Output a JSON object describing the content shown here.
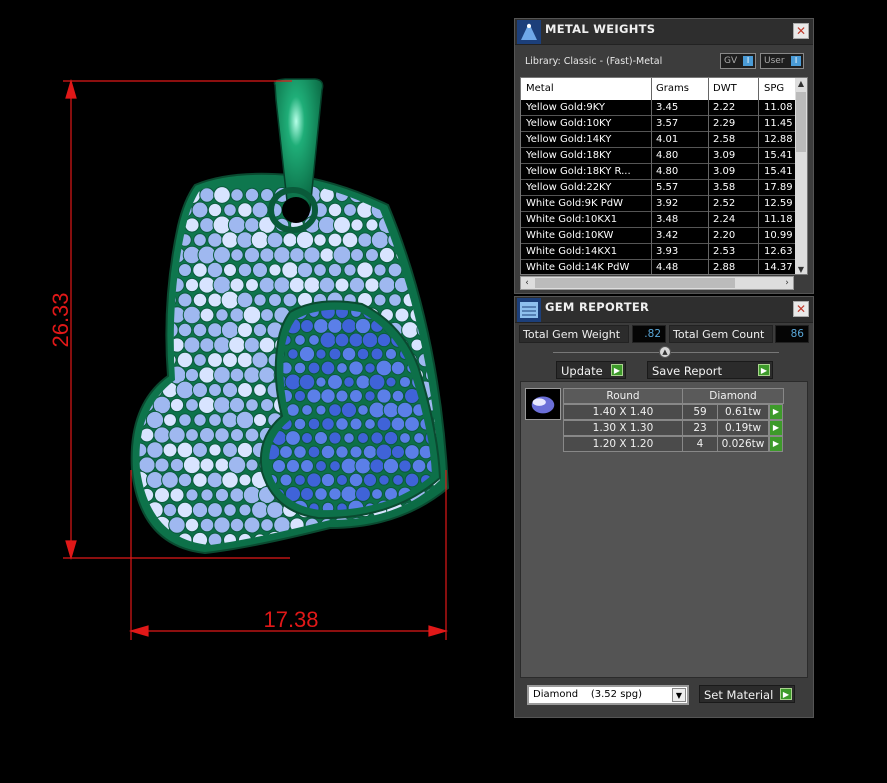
{
  "dimensions": {
    "height_label": "26.33",
    "width_label": "17.38",
    "line_color": "#e01818"
  },
  "metal_panel": {
    "title": "METAL WEIGHTS",
    "close": "✕",
    "library_label": "Library: Classic - (Fast)-Metal",
    "toggle_gv": "GV",
    "toggle_user": "User",
    "columns": [
      "Metal",
      "Grams",
      "DWT",
      "SPG"
    ],
    "rows": [
      {
        "metal": "Yellow Gold:9KY",
        "grams": "3.45",
        "dwt": "2.22",
        "spg": "11.08"
      },
      {
        "metal": "Yellow Gold:10KY",
        "grams": "3.57",
        "dwt": "2.29",
        "spg": "11.45"
      },
      {
        "metal": "Yellow Gold:14KY",
        "grams": "4.01",
        "dwt": "2.58",
        "spg": "12.88"
      },
      {
        "metal": "Yellow Gold:18KY",
        "grams": "4.80",
        "dwt": "3.09",
        "spg": "15.41"
      },
      {
        "metal": "Yellow Gold:18KY R...",
        "grams": "4.80",
        "dwt": "3.09",
        "spg": "15.41"
      },
      {
        "metal": "Yellow Gold:22KY",
        "grams": "5.57",
        "dwt": "3.58",
        "spg": "17.89"
      },
      {
        "metal": "White Gold:9K PdW",
        "grams": "3.92",
        "dwt": "2.52",
        "spg": "12.59"
      },
      {
        "metal": "White Gold:10KX1",
        "grams": "3.48",
        "dwt": "2.24",
        "spg": "11.18"
      },
      {
        "metal": "White Gold:10KW",
        "grams": "3.42",
        "dwt": "2.20",
        "spg": "10.99"
      },
      {
        "metal": "White Gold:14KX1",
        "grams": "3.93",
        "dwt": "2.53",
        "spg": "12.63"
      },
      {
        "metal": "White Gold:14K PdW",
        "grams": "4.48",
        "dwt": "2.88",
        "spg": "14.37"
      }
    ]
  },
  "gem_panel": {
    "title": "GEM REPORTER",
    "close": "✕",
    "total_weight_label": "Total Gem Weight",
    "total_weight_value": ".82",
    "total_count_label": "Total Gem Count",
    "total_count_value": "86",
    "update_label": "Update",
    "save_report_label": "Save Report",
    "table_shape": "Round",
    "table_material": "Diamond",
    "gems": [
      {
        "size": "1.40 X 1.40",
        "count": "59",
        "weight": "0.61tw"
      },
      {
        "size": "1.30 X 1.30",
        "count": "23",
        "weight": "0.19tw"
      },
      {
        "size": "1.20 X 1.20",
        "count": "4",
        "weight": "0.026tw"
      }
    ],
    "material_select": "Diamond    (3.52 spg)",
    "set_material_label": "Set Material"
  },
  "colors": {
    "metal_green": "#118a5a",
    "stone_light": "#9fb8f0",
    "stone_dark": "#3f63d8",
    "accent_blue": "#5aa7d8",
    "go_green": "#3d9a2a"
  }
}
